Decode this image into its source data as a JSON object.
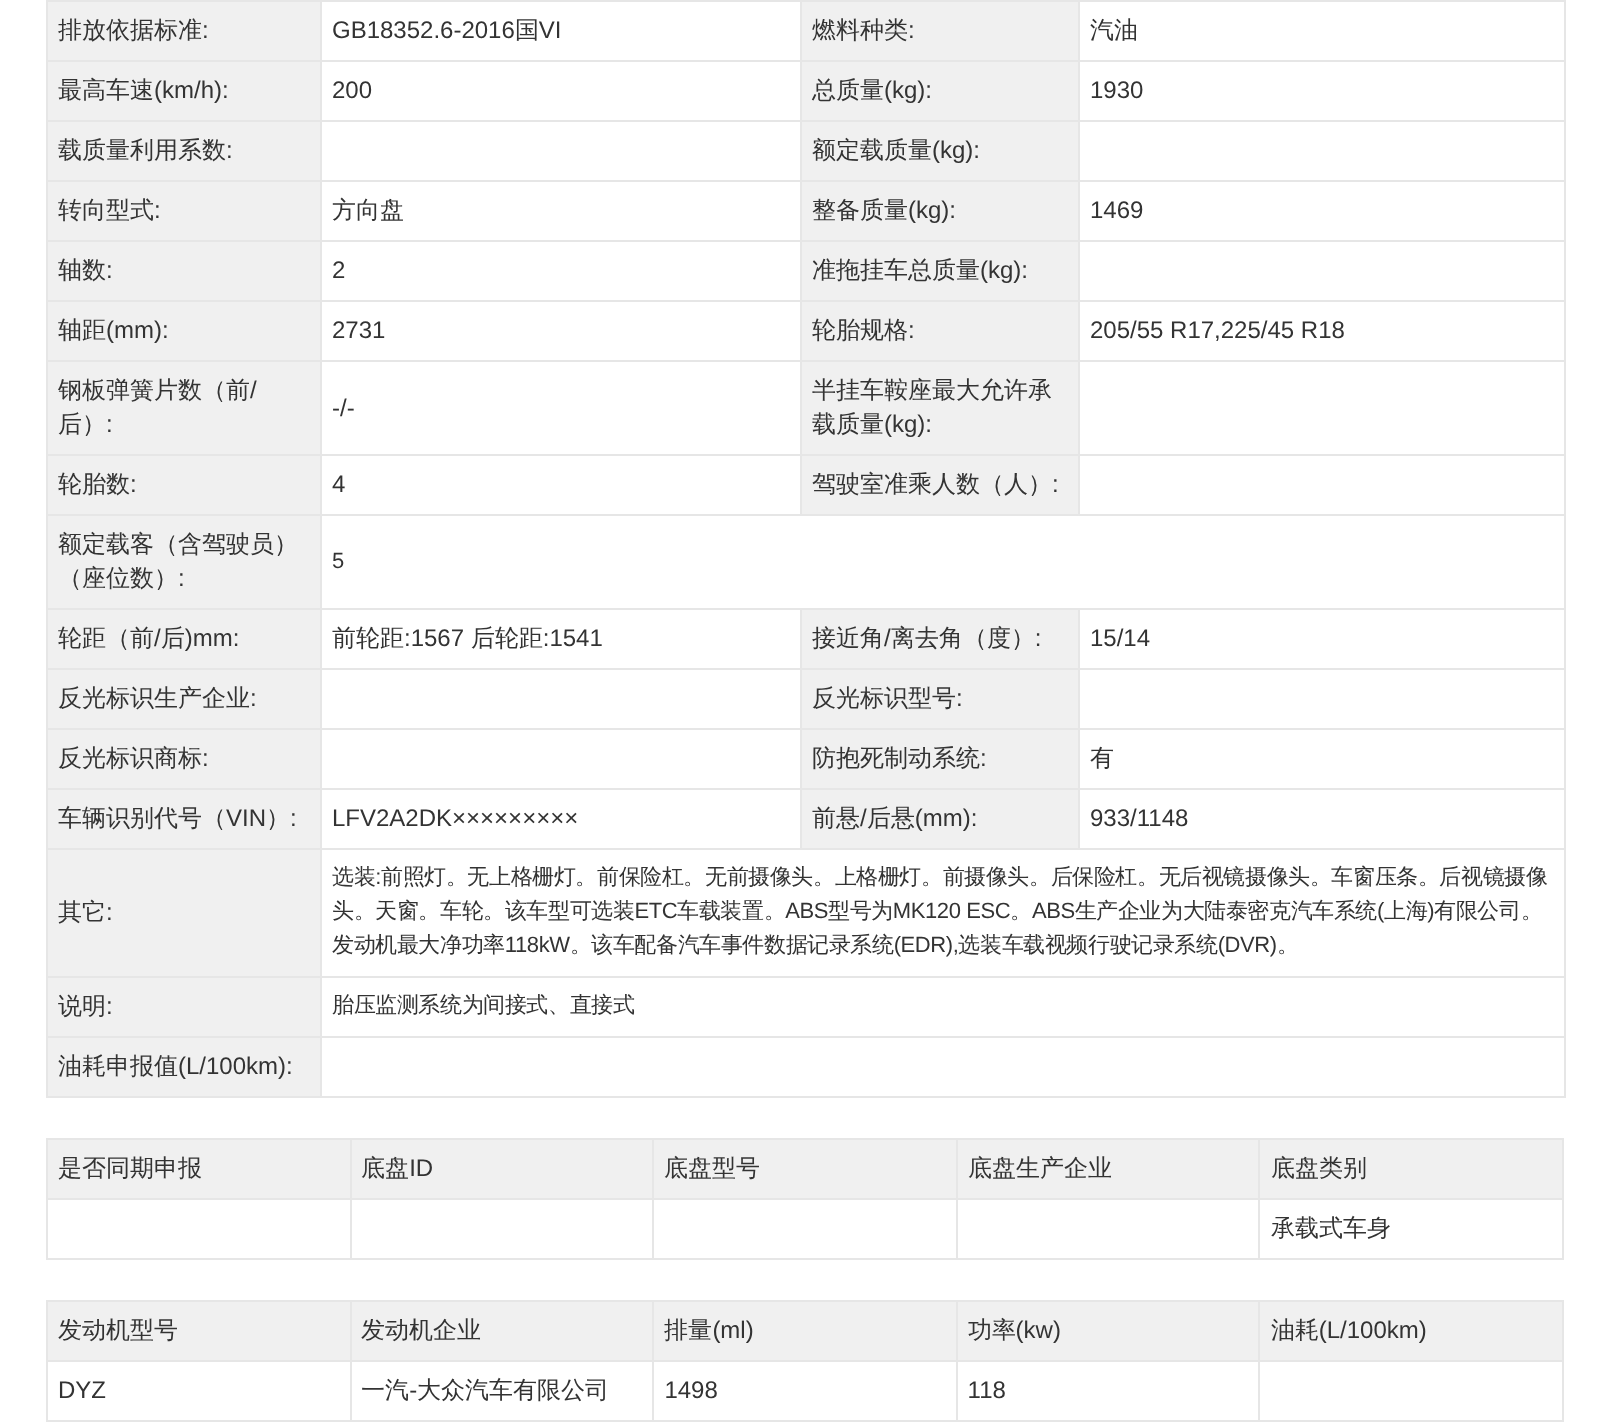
{
  "spec_table": {
    "rows": [
      {
        "cells": [
          {
            "kind": "label",
            "text": "排放依据标准:"
          },
          {
            "kind": "value",
            "text": "GB18352.6-2016国VI"
          },
          {
            "kind": "label",
            "text": "燃料种类:"
          },
          {
            "kind": "value",
            "text": "汽油"
          }
        ]
      },
      {
        "cells": [
          {
            "kind": "label",
            "text": "最高车速(km/h):"
          },
          {
            "kind": "value",
            "text": "200"
          },
          {
            "kind": "label",
            "text": "总质量(kg):"
          },
          {
            "kind": "value",
            "text": "1930"
          }
        ]
      },
      {
        "cells": [
          {
            "kind": "label",
            "text": "载质量利用系数:"
          },
          {
            "kind": "value"
          },
          {
            "kind": "label",
            "text": "额定载质量(kg):"
          },
          {
            "kind": "value"
          }
        ]
      },
      {
        "cells": [
          {
            "kind": "label",
            "text": "转向型式:"
          },
          {
            "kind": "value",
            "text": "方向盘"
          },
          {
            "kind": "label",
            "text": "整备质量(kg):"
          },
          {
            "kind": "value",
            "text": "1469"
          }
        ]
      },
      {
        "cells": [
          {
            "kind": "label",
            "text": "轴数:"
          },
          {
            "kind": "value",
            "text": "2"
          },
          {
            "kind": "label",
            "text": "准拖挂车总质量(kg):"
          },
          {
            "kind": "value"
          }
        ]
      },
      {
        "cells": [
          {
            "kind": "label",
            "text": "轴距(mm):"
          },
          {
            "kind": "value",
            "text": "2731"
          },
          {
            "kind": "label",
            "text": "轮胎规格:"
          },
          {
            "kind": "value",
            "text": "205/55 R17,225/45 R18"
          }
        ]
      },
      {
        "cells": [
          {
            "kind": "label",
            "text": "钢板弹簧片数（前/后）:"
          },
          {
            "kind": "value",
            "text": "-/-"
          },
          {
            "kind": "label",
            "text": "半挂车鞍座最大允许承载质量(kg):"
          },
          {
            "kind": "value"
          }
        ]
      },
      {
        "cells": [
          {
            "kind": "label",
            "text": "轮胎数:"
          },
          {
            "kind": "value",
            "text": "4"
          },
          {
            "kind": "label",
            "text": "驾驶室准乘人数（人）:"
          },
          {
            "kind": "value"
          }
        ]
      },
      {
        "cells": [
          {
            "kind": "label",
            "text": "额定载客（含驾驶员）（座位数）:"
          },
          {
            "kind": "wide",
            "text": "5",
            "colspan": 3
          }
        ]
      },
      {
        "cells": [
          {
            "kind": "label",
            "text": "轮距（前/后)mm:"
          },
          {
            "kind": "value",
            "text": "前轮距:1567 后轮距:1541"
          },
          {
            "kind": "label",
            "text": "接近角/离去角（度）:"
          },
          {
            "kind": "value",
            "text": "15/14"
          }
        ]
      },
      {
        "cells": [
          {
            "kind": "label",
            "text": "反光标识生产企业:"
          },
          {
            "kind": "value"
          },
          {
            "kind": "label",
            "text": "反光标识型号:"
          },
          {
            "kind": "value"
          }
        ]
      },
      {
        "cells": [
          {
            "kind": "label",
            "text": "反光标识商标:"
          },
          {
            "kind": "value"
          },
          {
            "kind": "label",
            "text": "防抱死制动系统:"
          },
          {
            "kind": "value",
            "text": "有"
          }
        ]
      },
      {
        "cells": [
          {
            "kind": "label",
            "text": "车辆识别代号（VIN）:"
          },
          {
            "kind": "value",
            "text": "LFV2A2DK×××××××××"
          },
          {
            "kind": "label",
            "text": "前悬/后悬(mm):"
          },
          {
            "kind": "value",
            "text": "933/1148"
          }
        ]
      },
      {
        "cells": [
          {
            "kind": "label",
            "text": "其它:"
          },
          {
            "kind": "wide",
            "colspan": 3,
            "text": "选装:前照灯。无上格栅灯。前保险杠。无前摄像头。上格栅灯。前摄像头。后保险杠。无后视镜摄像头。车窗压条。后视镜摄像头。天窗。车轮。该车型可选装ETC车载装置。ABS型号为MK120 ESC。ABS生产企业为大陆泰密克汽车系统(上海)有限公司。发动机最大净功率118kW。该车配备汽车事件数据记录系统(EDR),选装车载视频行驶记录系统(DVR)。"
          }
        ]
      },
      {
        "cells": [
          {
            "kind": "label",
            "text": "说明:"
          },
          {
            "kind": "wide",
            "text": "胎压监测系统为间接式、直接式",
            "colspan": 3
          }
        ]
      },
      {
        "cells": [
          {
            "kind": "label",
            "text": "油耗申报值(L/100km):"
          },
          {
            "kind": "wide",
            "colspan": 3
          }
        ]
      }
    ]
  },
  "chassis_table": {
    "columns": [
      "是否同期申报",
      "底盘ID",
      "底盘型号",
      "底盘生产企业",
      "底盘类别"
    ],
    "rows": [
      {
        "cells": [
          {},
          {},
          {},
          {},
          {
            "text": "承载式车身"
          }
        ]
      }
    ]
  },
  "engine_table": {
    "columns": [
      "发动机型号",
      "发动机企业",
      "排量(ml)",
      "功率(kw)",
      "油耗(L/100km)"
    ],
    "rows": [
      {
        "cells": [
          {
            "text": "DYZ"
          },
          {
            "text": "一汽-大众汽车有限公司"
          },
          {
            "text": "1498"
          },
          {
            "text": "118"
          },
          {}
        ]
      }
    ]
  }
}
